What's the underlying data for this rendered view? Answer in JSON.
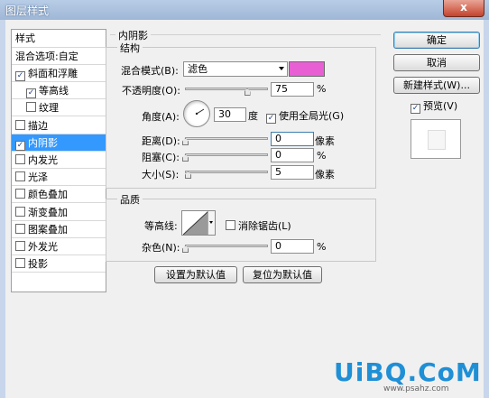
{
  "window": {
    "title": "图层样式",
    "close_glyph": "x"
  },
  "sidebar": {
    "header": "样式",
    "blend_options": "混合选项:自定",
    "items": [
      {
        "label": "斜面和浮雕",
        "checked": true
      },
      {
        "label": "等高线",
        "checked": true
      },
      {
        "label": "纹理",
        "checked": false
      },
      {
        "label": "描边",
        "checked": false
      },
      {
        "label": "内阴影",
        "checked": true,
        "selected": true
      },
      {
        "label": "内发光",
        "checked": false
      },
      {
        "label": "光泽",
        "checked": false
      },
      {
        "label": "颜色叠加",
        "checked": false
      },
      {
        "label": "渐变叠加",
        "checked": false
      },
      {
        "label": "图案叠加",
        "checked": false
      },
      {
        "label": "外发光",
        "checked": false
      },
      {
        "label": "投影",
        "checked": false
      }
    ]
  },
  "panel": {
    "title": "内阴影",
    "structure": {
      "title": "结构",
      "blend_mode_label": "混合模式(B):",
      "blend_mode_value": "滤色",
      "blend_color": "#e85fd4",
      "opacity_label": "不透明度(O):",
      "opacity_value": "75",
      "opacity_unit": "%",
      "opacity_fraction": 0.75,
      "angle_label": "角度(A):",
      "angle_value": "30",
      "angle_unit": "度",
      "global_light_label": "使用全局光(G)",
      "global_light_checked": true,
      "distance_label": "距离(D):",
      "distance_value": "0",
      "distance_unit": "像素",
      "choke_label": "阻塞(C):",
      "choke_value": "0",
      "choke_unit": "%",
      "size_label": "大小(S):",
      "size_value": "5",
      "size_unit": "像素"
    },
    "quality": {
      "title": "品质",
      "contour_label": "等高线:",
      "anti_alias_label": "消除锯齿(L)",
      "anti_alias_checked": false,
      "noise_label": "杂色(N):",
      "noise_value": "0",
      "noise_unit": "%"
    },
    "set_default": "设置为默认值",
    "reset_default": "复位为默认值"
  },
  "buttons": {
    "ok": "确定",
    "cancel": "取消",
    "new_style": "新建样式(W)...",
    "preview_label": "预览(V)",
    "preview_checked": true
  },
  "watermark": {
    "main": "UiBQ.CoM",
    "sub": "www.psahz.com"
  }
}
